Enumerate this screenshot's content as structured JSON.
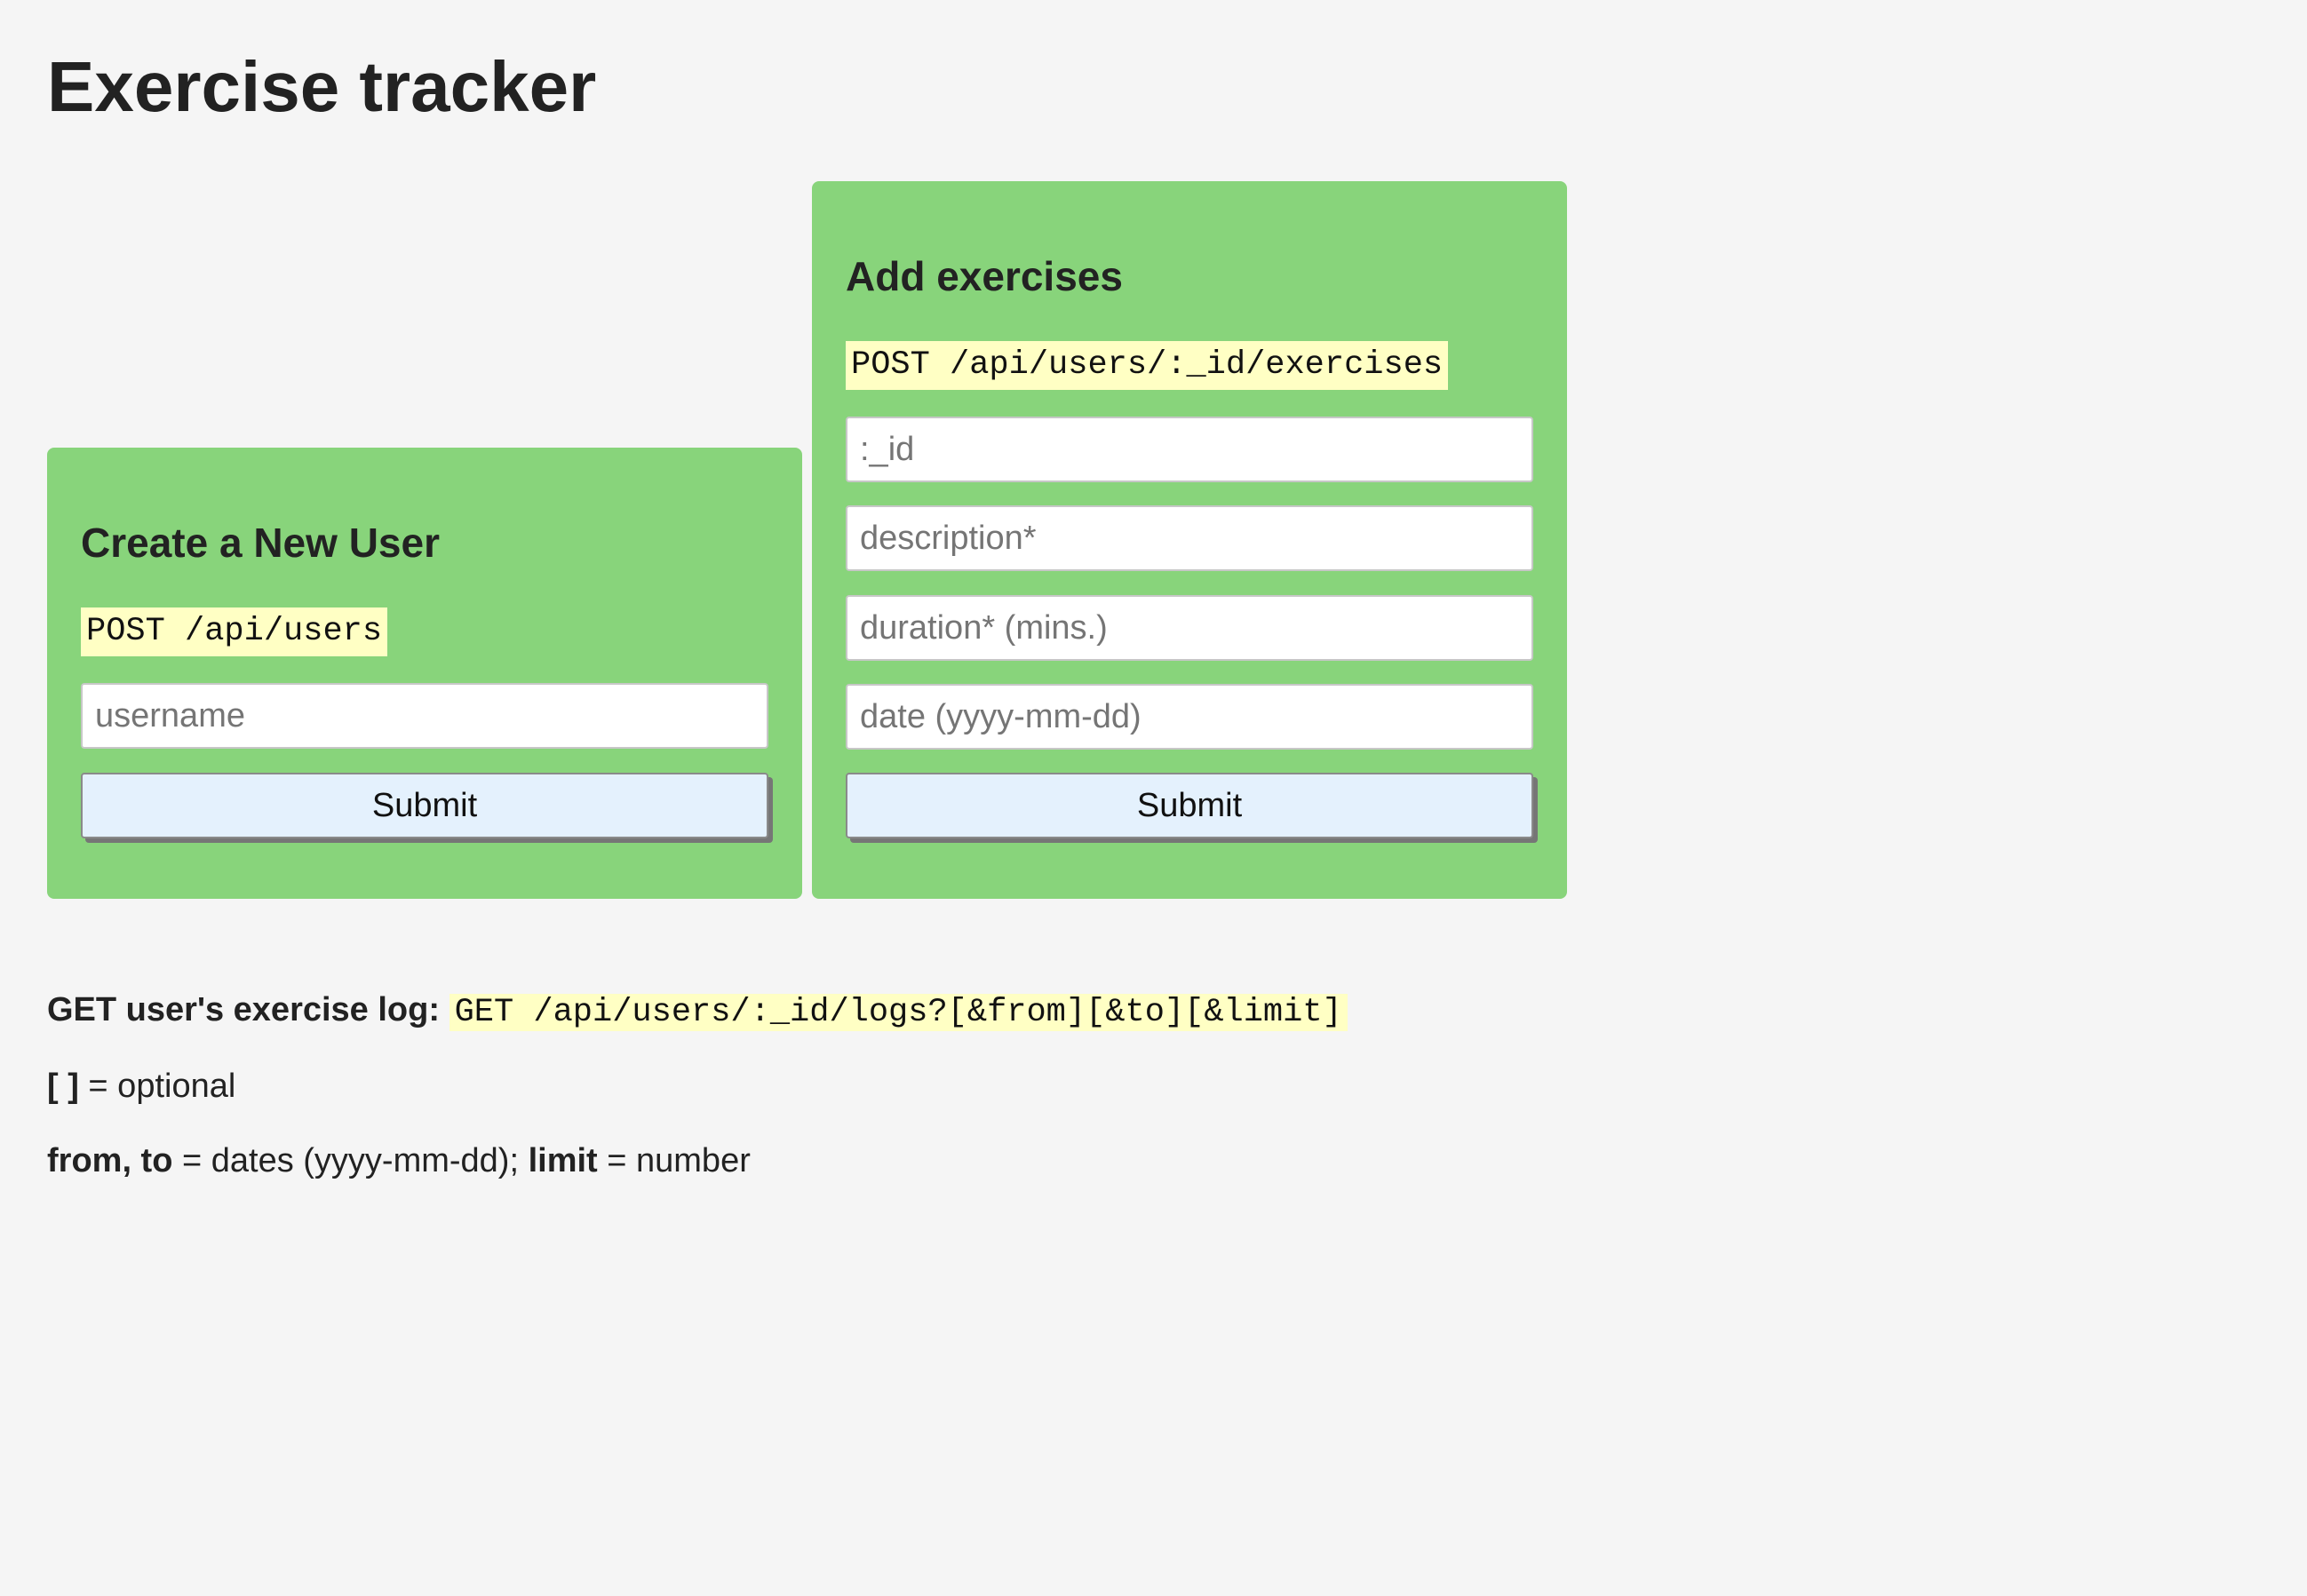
{
  "page": {
    "title": "Exercise tracker"
  },
  "create_user": {
    "heading": "Create a New User",
    "endpoint": "POST /api/users",
    "username_placeholder": "username",
    "submit_label": "Submit"
  },
  "add_exercise": {
    "heading": "Add exercises",
    "endpoint": "POST /api/users/:_id/exercises",
    "id_placeholder": ":_id",
    "description_placeholder": "description*",
    "duration_placeholder": "duration* (mins.)",
    "date_placeholder": "date (yyyy-mm-dd)",
    "submit_label": "Submit"
  },
  "info": {
    "log_label": "GET user's exercise log:",
    "log_endpoint": "GET /api/users/:_id/logs?[&from][&to][&limit]",
    "optional_symbol": "[ ]",
    "optional_text": " = optional",
    "from_to_label": "from, to",
    "dates_text": " = dates (yyyy-mm-dd); ",
    "limit_label": "limit",
    "number_text": " = number"
  },
  "colors": {
    "page_background": "#f5f5f5",
    "card_background": "#88d47b",
    "code_highlight": "#ffffc4",
    "button_background": "#e4f1fd"
  }
}
